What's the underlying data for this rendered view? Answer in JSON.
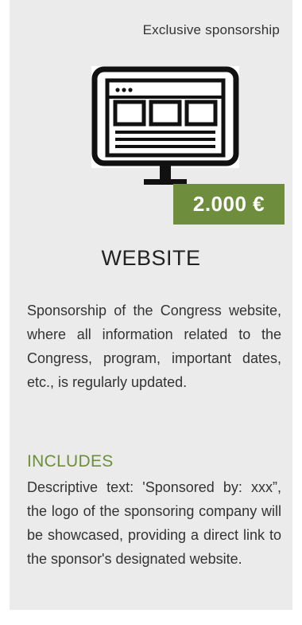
{
  "card": {
    "tag": "Exclusive sponsorship",
    "icon": "monitor-website-icon",
    "price": "2.000 €",
    "title": "WEBSITE",
    "description": "Sponsorship of the Congress website, where all information related to the Congress, program, important dates, etc., is regularly updated.",
    "includes_heading": "INCLUDES",
    "includes_text": "Descriptive text: 'Sponsored by: xxx”, the logo of the sponsoring company will be showcased, providing a direct link to the sponsor's designated website."
  },
  "colors": {
    "accent": "#6e8e3e",
    "card_background": "#ebebeb"
  }
}
